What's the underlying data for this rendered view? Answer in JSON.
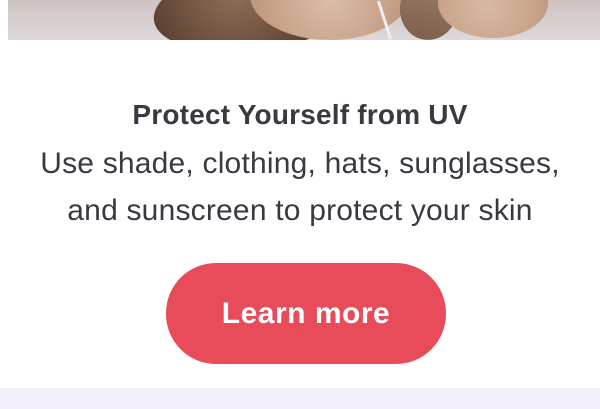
{
  "banner": {
    "title": "Protect Yourself from UV",
    "body_lines": [
      "Use shade, clothing, hats, sunglasses,",
      "and sunscreen to protect your skin"
    ],
    "cta_label": "Learn more"
  },
  "colors": {
    "title_text": "#3a3840",
    "cta_background": "#e84b5a",
    "cta_text": "#ffffff",
    "footer_band": "#f3f0fb"
  }
}
